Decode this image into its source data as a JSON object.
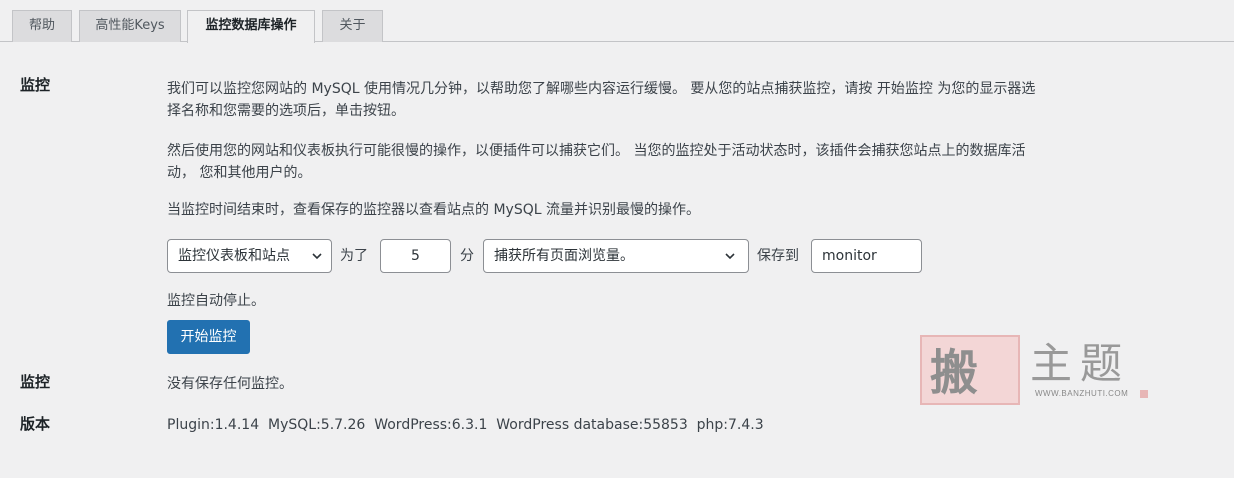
{
  "tabs": [
    {
      "label": "帮助",
      "active": false
    },
    {
      "label": "高性能Keys",
      "active": false
    },
    {
      "label": "监控数据库操作",
      "active": true
    },
    {
      "label": "关于",
      "active": false
    }
  ],
  "monitor_section": {
    "label": "监控",
    "paragraph1": "我们可以监控您网站的 MySQL 使用情况几分钟，以帮助您了解哪些内容运行缓慢。 要从您的站点捕获监控，请按 开始监控 为您的显示器选择名称和您需要的选项后，单击按钮。",
    "paragraph2": "然后使用您的网站和仪表板执行可能很慢的操作，以便插件可以捕获它们。 当您的监控处于活动状态时，该插件会捕获您站点上的数据库活动， 您和其他用户的。",
    "paragraph3": "当监控时间结束时，查看保存的监控器以查看站点的 MySQL 流量并识别最慢的操作。",
    "controls": {
      "target_select_value": "监控仪表板和站点",
      "for_label": "为了",
      "duration_value": "5",
      "minutes_label": "分",
      "capture_select_value": "捕获所有页面浏览量。",
      "save_to_label": "保存到",
      "name_value": "monitor"
    },
    "auto_stop_text": "监控自动停止。",
    "start_button_label": "开始监控"
  },
  "saved_section": {
    "label": "监控",
    "value": "没有保存任何监控。"
  },
  "version_section": {
    "label": "版本",
    "value": "Plugin:1.4.14  MySQL:5.7.26  WordPress:6.3.1  WordPress database:55853  php:7.4.3"
  },
  "watermark": {
    "stamp_char": "搬",
    "title": "主题",
    "url": "WWW.BANZHUTI.COM"
  },
  "colors": {
    "accent": "#2271b1",
    "background": "#f0f0f1",
    "tab_inactive": "#dcdcde"
  }
}
